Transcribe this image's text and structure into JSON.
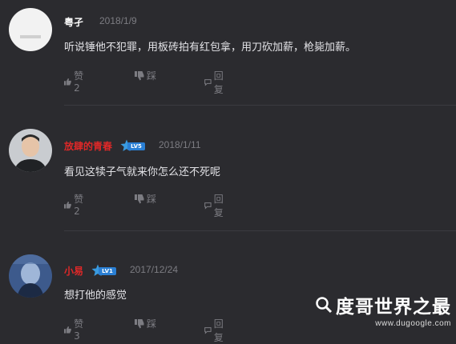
{
  "comments": [
    {
      "username": "粤孑",
      "username_color": "#ffffff",
      "date": "2018/1/9",
      "text": "听说锤他不犯罪，用板砖拍有红包拿，用刀砍加薪，枪毙加薪。",
      "actions": {
        "like_label": "赞2",
        "dislike_label": "踩",
        "reply_label": "回复"
      }
    },
    {
      "username": "放肆的青春",
      "username_color": "#e02828",
      "badge": "LV5",
      "date": "2018/1/11",
      "text": "看见这犊子气就来你怎么还不死呢",
      "actions": {
        "like_label": "赞2",
        "dislike_label": "踩",
        "reply_label": "回复"
      }
    },
    {
      "username": "小易",
      "username_color": "#e02828",
      "badge": "LV1",
      "date": "2017/12/24",
      "text": "想打他的感觉",
      "actions": {
        "like_label": "赞3",
        "dislike_label": "踩",
        "reply_label": "回复"
      }
    }
  ],
  "watermark": {
    "title": "度哥世界之最",
    "url": "www.dugoogle.com"
  },
  "colors": {
    "background": "#2b2b2f",
    "text": "#e2e2e6",
    "muted": "#7c7c82",
    "vip_name": "#e02828"
  }
}
